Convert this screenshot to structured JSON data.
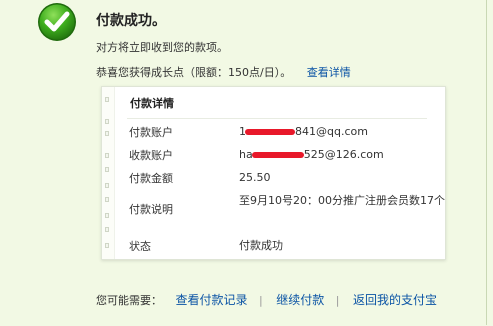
{
  "title": "付款成功。",
  "description": "对方将立即收到您的款项。",
  "points": {
    "text": "恭喜您获得成长点（限额：150点/日）。",
    "link": "查看详情"
  },
  "card": {
    "title": "付款详情",
    "rows": [
      {
        "label": "付款账户",
        "value_prefix": "1",
        "value_suffix": "841@qq.com"
      },
      {
        "label": "收款账户",
        "value_prefix": "ha",
        "value_suffix": "525@126.com"
      },
      {
        "label": "付款金额",
        "value": "25.50"
      },
      {
        "label": "付款说明",
        "value": "至9月10号20：00分推广注册会员数17个"
      },
      {
        "label": "状态",
        "value": "付款成功"
      }
    ]
  },
  "actions": {
    "prompt": "您可能需要：",
    "links": [
      "查看付款记录",
      "继续付款",
      "返回我的支付宝"
    ]
  },
  "colors": {
    "background": "#f2f9e4",
    "link": "#0b54a5",
    "success_green": "#3aa61e",
    "redaction": "#e8182a"
  },
  "icons": {
    "success": "check-circle-icon"
  }
}
